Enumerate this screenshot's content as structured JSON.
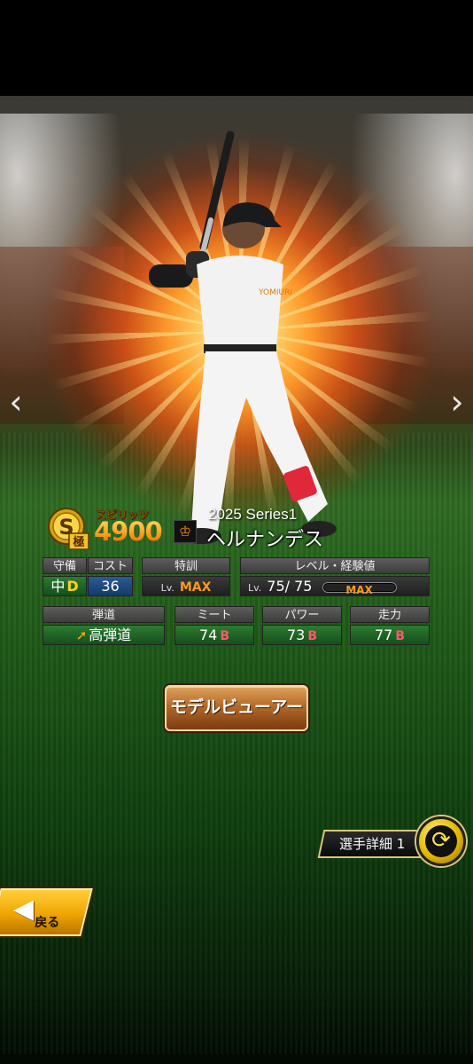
{
  "nav": {
    "prev_arrow": "‹",
    "next_arrow": "›"
  },
  "card": {
    "rank_letter": "S",
    "rank_sub": "極",
    "spirit_label": "スピリッツ",
    "spirit_value": "4900",
    "team_logo_glyph": "♔",
    "series": "2025 Series1",
    "player_name": "ヘルナンデス"
  },
  "defense": {
    "header": "守備",
    "position": "中",
    "grade": "D"
  },
  "cost": {
    "header": "コスト",
    "value": "36"
  },
  "training": {
    "header": "特訓",
    "lv_prefix": "Lv.",
    "value": "MAX"
  },
  "level": {
    "header": "レベル・経験値",
    "lv_prefix": "Lv.",
    "value": "75/ 75",
    "exp_label": "MAX",
    "exp_fraction": 1.0
  },
  "trajectory": {
    "header": "弾道",
    "icon": "arrow-up-right-icon",
    "value": "高弾道"
  },
  "meet": {
    "header": "ミート",
    "value": "74",
    "grade": "B"
  },
  "power": {
    "header": "パワー",
    "value": "73",
    "grade": "B"
  },
  "speed": {
    "header": "走力",
    "value": "77",
    "grade": "B"
  },
  "buttons": {
    "model_viewer": "モデルビューアー",
    "player_detail": "選手詳細 1",
    "back": "戻る"
  },
  "colors": {
    "accent_orange": "#ff9a18",
    "grade_b": "#ff5a6a",
    "grade_d": "#ffd21a",
    "turf": "#1f5a18"
  }
}
